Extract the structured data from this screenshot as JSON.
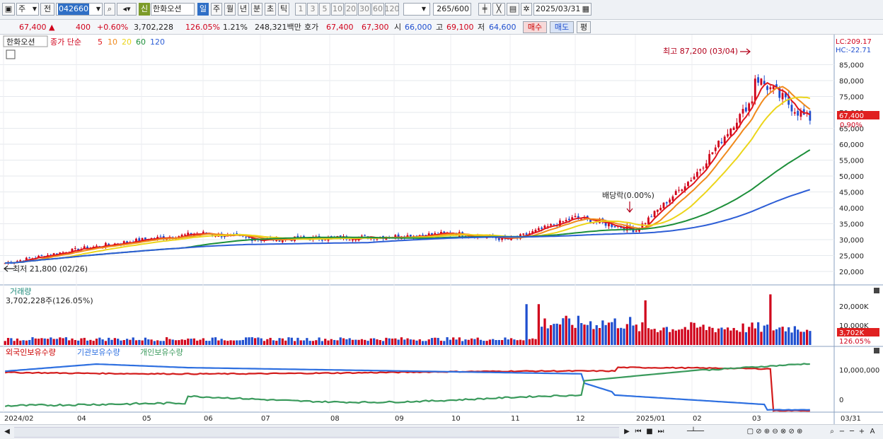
{
  "toolbar": {
    "period_type": "주",
    "prev_label": "전",
    "stock_code": "042660",
    "new_badge": "신",
    "stock_name": "한화오션",
    "periods": [
      "일",
      "주",
      "월",
      "년",
      "분",
      "초",
      "틱"
    ],
    "active_period": "일",
    "intervals": [
      "1",
      "3",
      "5",
      "10",
      "20",
      "30",
      "60",
      "120"
    ],
    "count": "265",
    "count_max": "/600",
    "date": "2025/03/31"
  },
  "quote": {
    "price": "67,400 ▲",
    "change": "400",
    "change_pct": "+0.60%",
    "volume": "3,702,228",
    "volume_ratio": "126.05%",
    "turnover": "1.21%",
    "amount": "248,321백만",
    "bid_label": "호가",
    "ask_price": "67,400",
    "bid_price": "67,300",
    "open_label": "시",
    "open": "66,000",
    "high_label": "고",
    "high": "69,100",
    "low_label": "저",
    "low": "64,600",
    "buy_label": "매수",
    "sell_label": "매도",
    "eval_label": "평"
  },
  "price_panel": {
    "stock_name": "한화오션",
    "legend_prefix": "종가 단순",
    "ma_labels": [
      "5",
      "10",
      "20",
      "60",
      "120"
    ],
    "lc_label": "LC:209.17",
    "hc_label": "HC:-22.71",
    "current_price_tag": "67,400",
    "current_pct_tag": "0.90%",
    "high_annotation": "최고 87,200 (03/04)",
    "low_annotation": "최저 21,800 (02/26)",
    "dividend_annotation": "배당락(0.00%)",
    "yaxis": [
      "85,000",
      "80,000",
      "75,000",
      "70,000",
      "65,000",
      "60,000",
      "55,000",
      "50,000",
      "45,000",
      "40,000",
      "35,000",
      "30,000",
      "25,000",
      "20,000"
    ]
  },
  "volume_panel": {
    "title": "거래량",
    "value": "3,702,228주(126.05%)",
    "yaxis": [
      "20,000K",
      "10,000K"
    ],
    "current_tag": "3,702K",
    "pct_tag": "126.05%"
  },
  "holding_panel": {
    "legend": [
      "외국인보유수량",
      "기관보유수량",
      "개인보유수량"
    ],
    "yaxis": [
      "10,000,000",
      "0"
    ]
  },
  "xaxis": [
    "2024/02",
    "04",
    "05",
    "06",
    "07",
    "08",
    "09",
    "10",
    "11",
    "12",
    "2025/01",
    "02",
    "03",
    "03/31"
  ],
  "colors": {
    "up": "#d0021b",
    "down": "#1f4fcf",
    "ma5": "#e0161b",
    "ma10": "#f08a1c",
    "ma20": "#ecd51a",
    "ma60": "#1d8f3a",
    "ma120": "#2d5ed6",
    "foreign": "#d31b1b",
    "institution": "#2d6fe0",
    "individual": "#3a9a5c"
  },
  "chart_data": {
    "type": "candlestick",
    "price_range": [
      18000,
      90000
    ],
    "monthly_close": [
      {
        "x": "2024/02",
        "close": 23000
      },
      {
        "x": "03",
        "close": 27000
      },
      {
        "x": "04",
        "close": 30000
      },
      {
        "x": "05",
        "close": 32000
      },
      {
        "x": "06",
        "close": 30000
      },
      {
        "x": "07",
        "close": 30500
      },
      {
        "x": "08",
        "close": 31000
      },
      {
        "x": "09",
        "close": 32000
      },
      {
        "x": "10",
        "close": 30000
      },
      {
        "x": "11",
        "close": 37000
      },
      {
        "x": "12",
        "close": 33000
      },
      {
        "x": "2025/01",
        "close": 50000
      },
      {
        "x": "02",
        "close": 74000
      },
      {
        "x": "03",
        "close": 67400
      }
    ],
    "high": {
      "value": 87200,
      "date": "03/04"
    },
    "low": {
      "value": 21800,
      "date": "02/26"
    },
    "last": 67400
  }
}
